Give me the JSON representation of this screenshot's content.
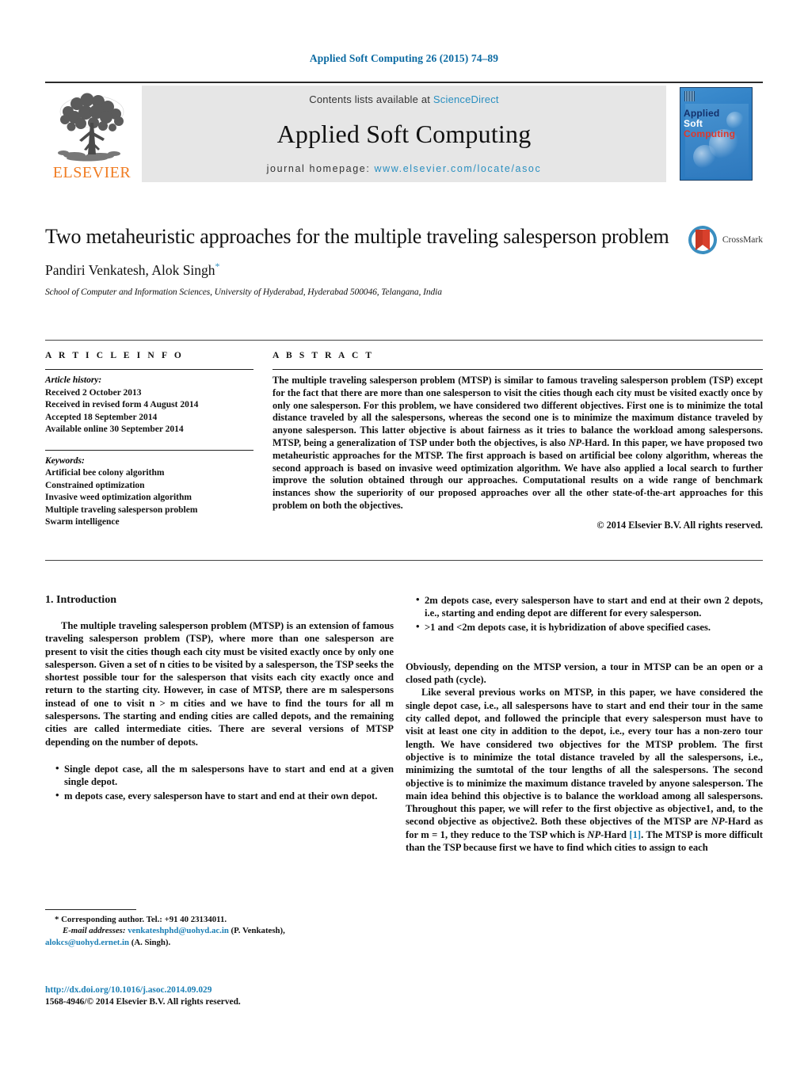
{
  "running_head": "Applied Soft Computing 26 (2015) 74–89",
  "masthead": {
    "publisher_name": "ELSEVIER",
    "contents_prefix": "Contents lists available at ",
    "contents_link": "ScienceDirect",
    "journal_name": "Applied Soft Computing",
    "homepage_prefix": "journal homepage: ",
    "homepage_url": "www.elsevier.com/locate/asoc",
    "cover": {
      "line1": "Applied",
      "line2": "Soft",
      "line3": "Computing",
      "color_line1": "#13306b",
      "color_line2": "#ffffff",
      "color_line3": "#e0372b",
      "background": "#2f7fc4"
    },
    "link_color": "#2a8fc0",
    "band_background": "#e6e6e6"
  },
  "title_block": {
    "title": "Two metaheuristic approaches for the multiple traveling salesperson problem",
    "authors": "Pandiri Venkatesh, Alok Singh",
    "corresponding_marker": "*",
    "affiliation": "School of Computer and Information Sciences, University of Hyderabad, Hyderabad 500046, Telangana, India",
    "crossmark_label": "CrossMark"
  },
  "article_info": {
    "heading": "A R T I C L E     I N F O",
    "history_label": "Article history:",
    "history": [
      "Received 2 October 2013",
      "Received in revised form 4 August 2014",
      "Accepted 18 September 2014",
      "Available online 30 September 2014"
    ],
    "keywords_label": "Keywords:",
    "keywords": [
      "Artificial bee colony algorithm",
      "Constrained optimization",
      "Invasive weed optimization algorithm",
      "Multiple traveling salesperson problem",
      "Swarm intelligence"
    ]
  },
  "abstract": {
    "heading": "A B S T R A C T",
    "part1": "The multiple traveling salesperson problem (MTSP) is similar to famous traveling salesperson problem (TSP) except for the fact that there are more than one salesperson to visit the cities though each city must be visited exactly once by only one salesperson. For this problem, we have considered two different objectives. First one is to minimize the total distance traveled by all the salespersons, whereas the second one is to minimize the maximum distance traveled by anyone salesperson. This latter objective is about fairness as it tries to balance the workload among salespersons. MTSP, being a generalization of TSP under both the objectives, is also ",
    "np_hard_1": "NP",
    "part2": "-Hard. In this paper, we have proposed two metaheuristic approaches for the MTSP. The first approach is based on artificial bee colony algorithm, whereas the second approach is based on invasive weed optimization algorithm. We have also applied a local search to further improve the solution obtained through our approaches. Computational results on a wide range of benchmark instances show the superiority of our proposed approaches over all the other state-of-the-art approaches for this problem on both the objectives.",
    "copyright": "© 2014 Elsevier B.V. All rights reserved."
  },
  "introduction": {
    "section_number_title": "1.  Introduction",
    "para1": "The multiple traveling salesperson problem (MTSP) is an extension of famous traveling salesperson problem (TSP), where more than one salesperson are present to visit the cities though each city must be visited exactly once by only one salesperson. Given a set of n cities to be visited by a salesperson, the TSP seeks the shortest possible tour for the salesperson that visits each city exactly once and return to the starting city. However, in case of MTSP, there are m salespersons instead of one to visit n > m cities and we have to find the tours for all m salespersons. The starting and ending cities are called depots, and the remaining cities are called intermediate cities. There are several versions of MTSP depending on the number of depots.",
    "bullets": [
      "Single depot case, all the m salespersons have to start and end at a given single depot.",
      "m depots case, every salesperson have to start and end at their own depot.",
      "2m depots case, every salesperson have to start and end at their own 2 depots, i.e., starting and ending depot are different for every salesperson.",
      ">1 and <2m depots case, it is hybridization of above specified cases."
    ],
    "para2": "Obviously, depending on the MTSP version, a tour in MTSP can be an open or a closed path (cycle).",
    "para3_a": "Like several previous works on MTSP, in this paper, we have considered the single depot case, i.e., all salespersons have to start and end their tour in the same city called depot, and followed the principle that every salesperson must have to visit at least one city in addition to the depot, i.e., every tour has a non-zero tour length. We have considered two objectives for the MTSP problem. The first objective is to minimize the total distance traveled by all the salespersons, i.e., minimizing the sumtotal of the tour lengths of all the salespersons. The second objective is to minimize the maximum distance traveled by anyone salesperson. The main idea behind this objective is to balance the workload among all salespersons. Throughout this paper, we will refer to the first objective as objective1, and, to the second objective as objective2. Both these objectives of the MTSP are ",
    "np_1": "NP",
    "para3_b": "-Hard as for m = 1, they reduce to the TSP which is ",
    "np_2": "NP",
    "para3_c": "-Hard ",
    "reference_link": "[1]",
    "para3_d": ". The MTSP is more difficult than the TSP because first we have to find which cities to assign to each"
  },
  "footnotes": {
    "corresponding_marker": "*",
    "corresponding_text": " Corresponding author. Tel.: +91 40 23134011.",
    "email_label": "E-mail addresses:",
    "email1": "venkateshphd@uohyd.ac.in",
    "email1_owner": " (P. Venkatesh),",
    "email2": "alokcs@uohyd.ernet.in",
    "email2_owner": " (A. Singh).",
    "doi": "http://dx.doi.org/10.1016/j.asoc.2014.09.029",
    "issn": "1568-4946/© 2014 Elsevier B.V. All rights reserved."
  }
}
